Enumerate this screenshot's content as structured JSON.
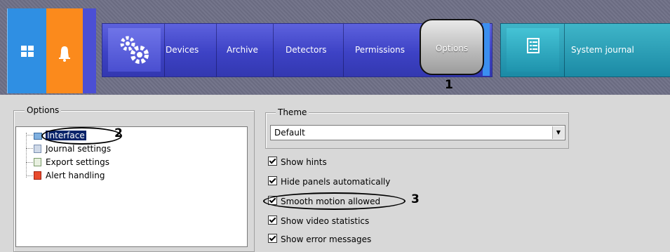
{
  "nav": {
    "items": [
      "Devices",
      "Archive",
      "Detectors",
      "Permissions"
    ],
    "active": "Options",
    "journal": "System journal"
  },
  "panel": {
    "legend": "Options",
    "tree": [
      "Interface",
      "Journal settings",
      "Export settings",
      "Alert handling"
    ],
    "theme_legend": "Theme",
    "theme_value": "Default",
    "checkboxes": [
      "Show hints",
      "Hide panels automatically",
      "Smooth motion allowed",
      "Show video statistics",
      "Show error messages"
    ]
  },
  "callouts": [
    "1",
    "2",
    "3"
  ],
  "colors": {
    "blue_tile": "#2f8fe3",
    "orange_tile": "#fb8a1c",
    "nav_blue": "#4a4fd0",
    "teal": "#2aa0ba"
  }
}
